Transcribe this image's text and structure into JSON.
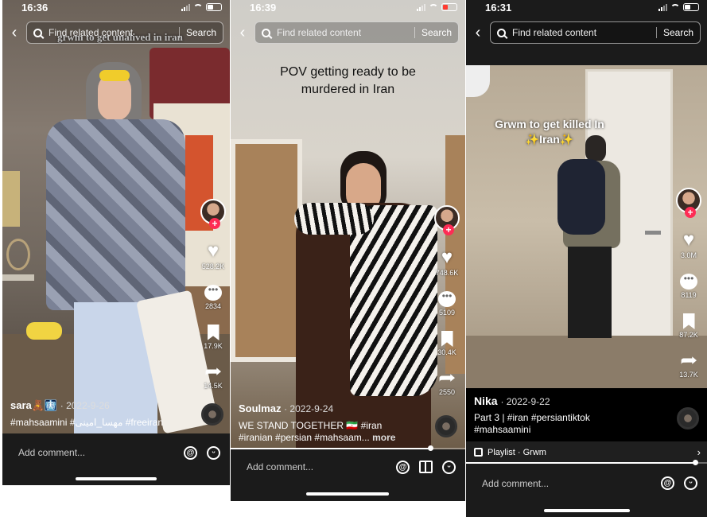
{
  "phones": [
    {
      "time": "16:36",
      "search_placeholder": "Find related content",
      "search_button": "Search",
      "caption": "grwm to get unalived in iran",
      "likes": "528.2K",
      "comments": "2834",
      "saves": "17.9K",
      "shares": "14.5K",
      "author": "sara🧸🩻",
      "date": "· 2022-9-26",
      "description": "#mahsaamini #مهسا_امینی #freeiran",
      "comment_placeholder": "Add comment...",
      "progress_fraction": 0
    },
    {
      "time": "16:39",
      "search_placeholder": "Find related content",
      "search_button": "Search",
      "caption": "POV getting ready to be murdered in Iran",
      "likes": "748.6K",
      "comments": "5109",
      "saves": "30.4K",
      "shares": "2550",
      "author": "Soulmaz",
      "date": "· 2022-9-24",
      "description_line1": "WE STAND TOGETHER 🇮🇷 #iran",
      "description_line2": "#iranian #persian #mahsaam...",
      "more": "more",
      "comment_placeholder": "Add comment...",
      "progress_fraction": 0.85
    },
    {
      "time": "16:31",
      "search_placeholder": "Find related content",
      "search_button": "Search",
      "caption": "Grwm to get killed In ✨Iran✨",
      "likes": "3.0M",
      "comments": "8119",
      "saves": "87.2K",
      "shares": "13.7K",
      "author": "Nika",
      "date": "· 2022-9-22",
      "description_line1": "Part 3 | #iran #persiantiktok",
      "description_line2": "#mahsaamini",
      "playlist": "Playlist · Grwm",
      "comment_placeholder": "Add comment...",
      "progress_fraction": 0.95
    }
  ],
  "colors": {
    "accent_red": "#fe2c55",
    "background": "#1b1b1b"
  }
}
